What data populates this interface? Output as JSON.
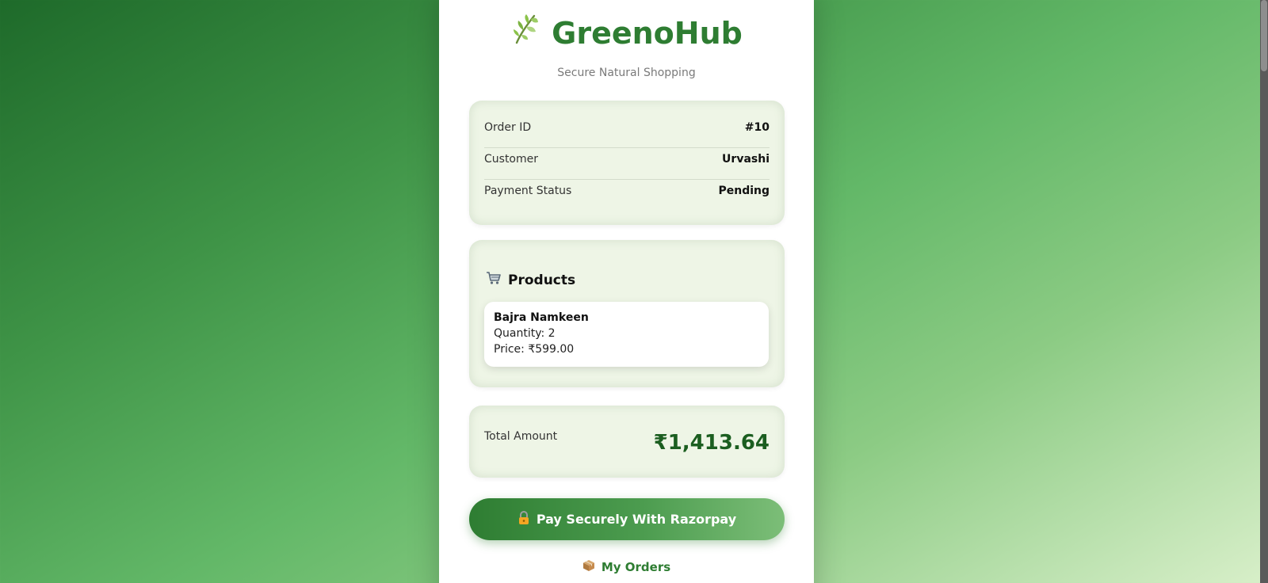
{
  "brand": {
    "name": "GreenoHub",
    "subtitle": "Secure Natural Shopping",
    "icon": "herb-leaf-icon"
  },
  "order_info": {
    "rows": [
      {
        "label": "Order ID",
        "value": "#10"
      },
      {
        "label": "Customer",
        "value": "Urvashi"
      },
      {
        "label": "Payment Status",
        "value": "Pending"
      }
    ]
  },
  "products": {
    "title": "Products",
    "icon": "shopping-cart-icon",
    "items": [
      {
        "name": "Bajra Namkeen",
        "quantity": "Quantity: 2",
        "price": "Price: ₹599.00"
      }
    ]
  },
  "total": {
    "label": "Total Amount",
    "value": "₹1,413.64"
  },
  "actions": {
    "pay_label": "Pay Securely With Razorpay",
    "pay_icon": "lock-icon",
    "orders_label": "My Orders",
    "orders_icon": "package-box-icon"
  },
  "colors": {
    "brand_green": "#2e7d32",
    "total_green": "#1b5e20",
    "panel_bg": "#eef5e6"
  }
}
